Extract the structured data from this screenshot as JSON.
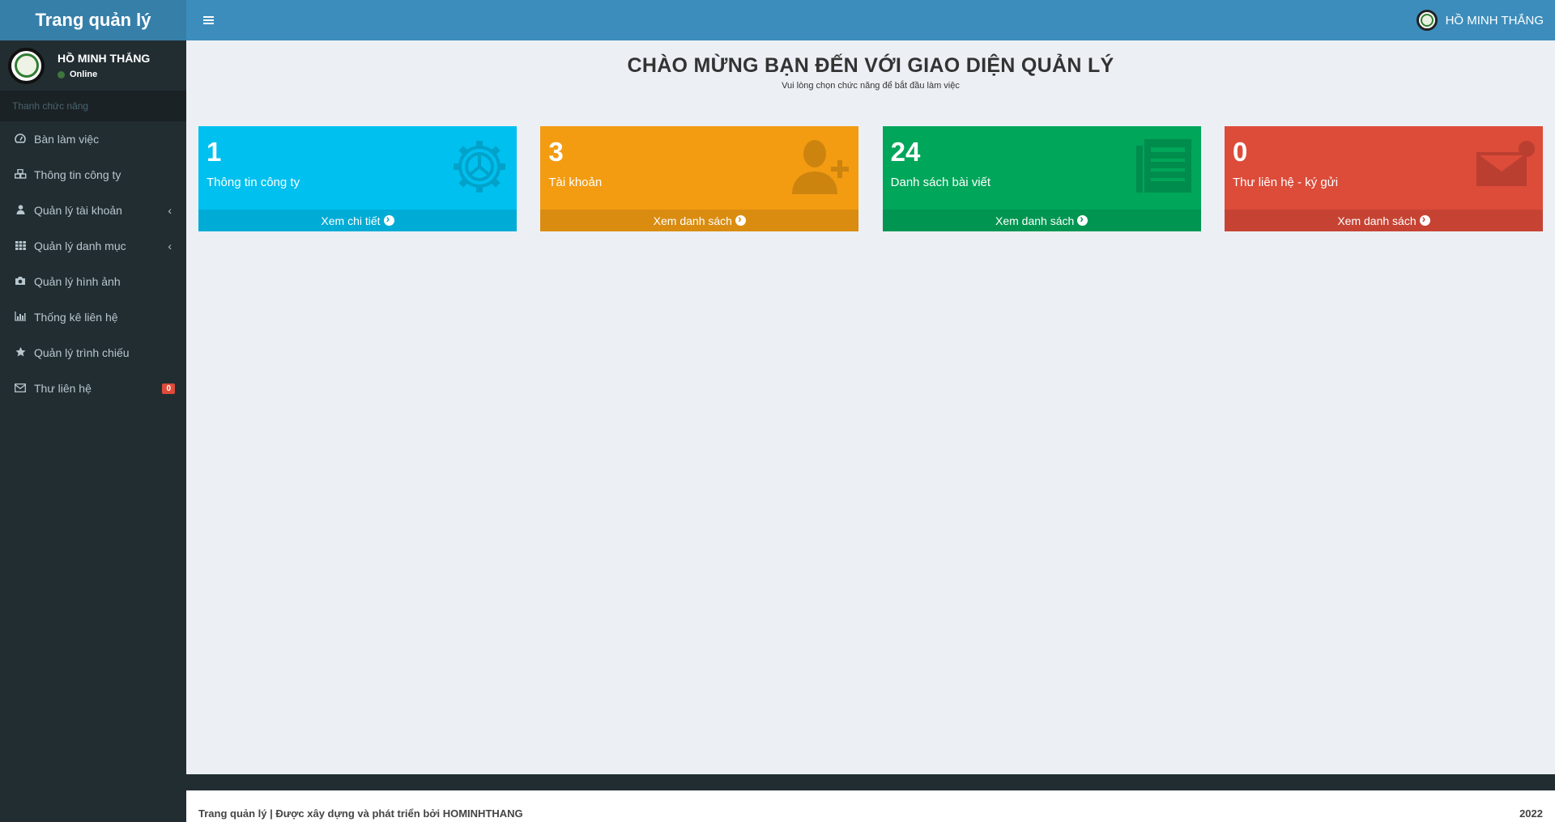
{
  "app": {
    "logo_text": "Trang quản lý"
  },
  "navbar": {
    "user_name": "HỒ MINH THẮNG"
  },
  "sidebar": {
    "user_name": "HỒ MINH THẮNG",
    "status": "Online",
    "header": "Thanh chức năng",
    "items": [
      {
        "label": "Bàn làm việc",
        "icon": "dashboard-icon"
      },
      {
        "label": "Thông tin công ty",
        "icon": "cubes-icon"
      },
      {
        "label": "Quản lý tài khoản",
        "icon": "user-icon",
        "has_children": true
      },
      {
        "label": "Quản lý danh mục",
        "icon": "grid-icon",
        "has_children": true
      },
      {
        "label": "Quản lý hình ảnh",
        "icon": "camera-icon"
      },
      {
        "label": "Thống kê liên hệ",
        "icon": "bar-chart-icon"
      },
      {
        "label": "Quản lý trình chiếu",
        "icon": "star-icon"
      },
      {
        "label": "Thư liên hệ",
        "icon": "envelope-icon",
        "badge": "0"
      }
    ]
  },
  "main": {
    "title": "CHÀO MỪNG BẠN ĐẾN VỚI GIAO DIỆN QUẢN LÝ",
    "subtitle": "Vui lòng chọn chức năng để bắt đầu làm việc",
    "boxes": [
      {
        "number": "1",
        "label": "Thông tin công ty",
        "link": "Xem chi tiết",
        "color": "#00c0ef",
        "icon": "gear-icon"
      },
      {
        "number": "3",
        "label": "Tài khoản",
        "link": "Xem danh sách",
        "color": "#f39c12",
        "icon": "user-plus-icon"
      },
      {
        "number": "24",
        "label": "Danh sách bài viết",
        "link": "Xem danh sách",
        "color": "#00a65a",
        "icon": "newspaper-icon"
      },
      {
        "number": "0",
        "label": "Thư liên hệ - ký gửi",
        "link": "Xem danh sách",
        "color": "#dd4b39",
        "icon": "envelope-icon"
      }
    ]
  },
  "footer": {
    "left": "Trang quản lý | Được xây dựng và phát triển bởi HOMINHTHANG",
    "right": "2022"
  }
}
